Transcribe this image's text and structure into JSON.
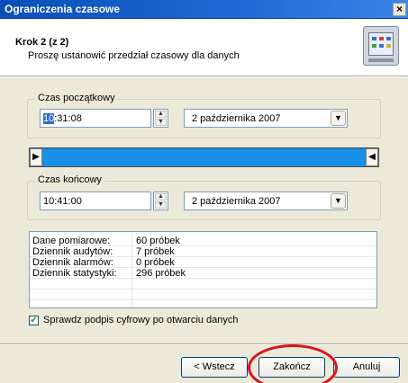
{
  "window": {
    "title": "Ograniczenia czasowe",
    "close_glyph": "×"
  },
  "header": {
    "step": "Krok 2 (z 2)",
    "subtitle": "Proszę ustanowić przedział czasowy dla danych",
    "icon": "recorder-device-icon"
  },
  "start": {
    "label": "Czas początkowy",
    "time_selected": "10",
    "time_rest": ":31:08",
    "date": "2 października 2007"
  },
  "range_slider": {
    "left_glyph": "▶",
    "right_glyph": "◀",
    "fill_color": "#1a8fe6"
  },
  "end": {
    "label": "Czas końcowy",
    "time": "10:41:00",
    "date": "2 października 2007"
  },
  "summary": [
    {
      "label": "Dane pomiarowe:",
      "value": "60 próbek"
    },
    {
      "label": "Dziennik audytów:",
      "value": "7 próbek"
    },
    {
      "label": "Dziennik alarmów:",
      "value": "0 próbek"
    },
    {
      "label": "Dziennik statystyki:",
      "value": "296 próbek"
    }
  ],
  "verify": {
    "label": "Sprawdz podpis cyfrowy po otwarciu danych",
    "checked": true,
    "glyph": "✔"
  },
  "buttons": {
    "back": "< Wstecz",
    "finish": "Zakończ",
    "cancel": "Anuluj"
  },
  "glyphs": {
    "spin_up": "▲",
    "spin_down": "▼",
    "combo_arrow": "▼"
  },
  "colors": {
    "title_bar": "#1e6ad6",
    "highlight_circle": "#d8141c",
    "selection": "#316ac5"
  }
}
